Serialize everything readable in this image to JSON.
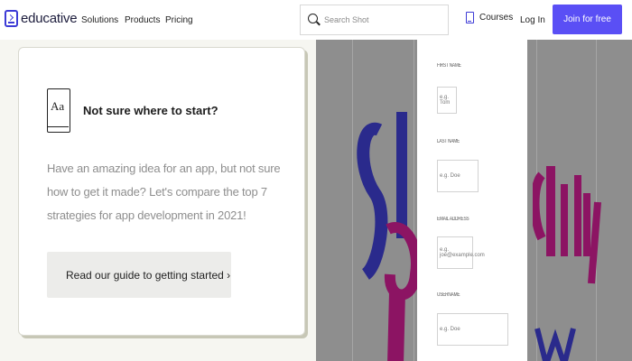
{
  "nav": {
    "logo_text": "educative",
    "links": [
      "Solutions",
      "Products",
      "Pricing"
    ],
    "search_placeholder": "Search Shot",
    "courses_label": "Courses",
    "login_label": "Log In",
    "join_label": "Join for free",
    "accent_color": "#5a4ff5"
  },
  "card": {
    "icon_text": "Aa",
    "title": "Not sure where to start?",
    "body": "Have an amazing idea for an app, but not sure how to get it made? Let's compare the top 7 strategies for app development in 2021!",
    "cta_label": "Read our guide to getting started ›"
  },
  "form": {
    "fields": [
      {
        "label": "FIRST NAME",
        "value": "e.g. Tom"
      },
      {
        "label": "LAST NAME",
        "value": "e.g. Doe"
      },
      {
        "label": "EMAIL ADDRESS",
        "value": "e.g. joe@example.com"
      },
      {
        "label": "USERNAME",
        "value": "e.g. Doe"
      }
    ]
  }
}
